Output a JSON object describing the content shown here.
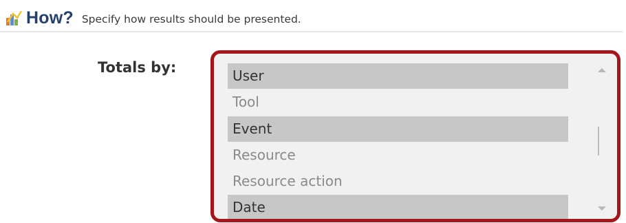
{
  "header": {
    "icon": "chart-icon",
    "title": "How?",
    "description": "Specify how results should be presented."
  },
  "totals": {
    "label": "Totals by:",
    "options": [
      {
        "label": "User",
        "selected": true
      },
      {
        "label": "Tool",
        "selected": false
      },
      {
        "label": "Event",
        "selected": true
      },
      {
        "label": "Resource",
        "selected": false
      },
      {
        "label": "Resource action",
        "selected": false
      },
      {
        "label": "Date",
        "selected": true
      }
    ]
  },
  "colors": {
    "title": "#24406b",
    "highlight_border": "#a4161a",
    "selected_bg": "#c7c7c7",
    "list_bg": "#f1f1f1"
  }
}
